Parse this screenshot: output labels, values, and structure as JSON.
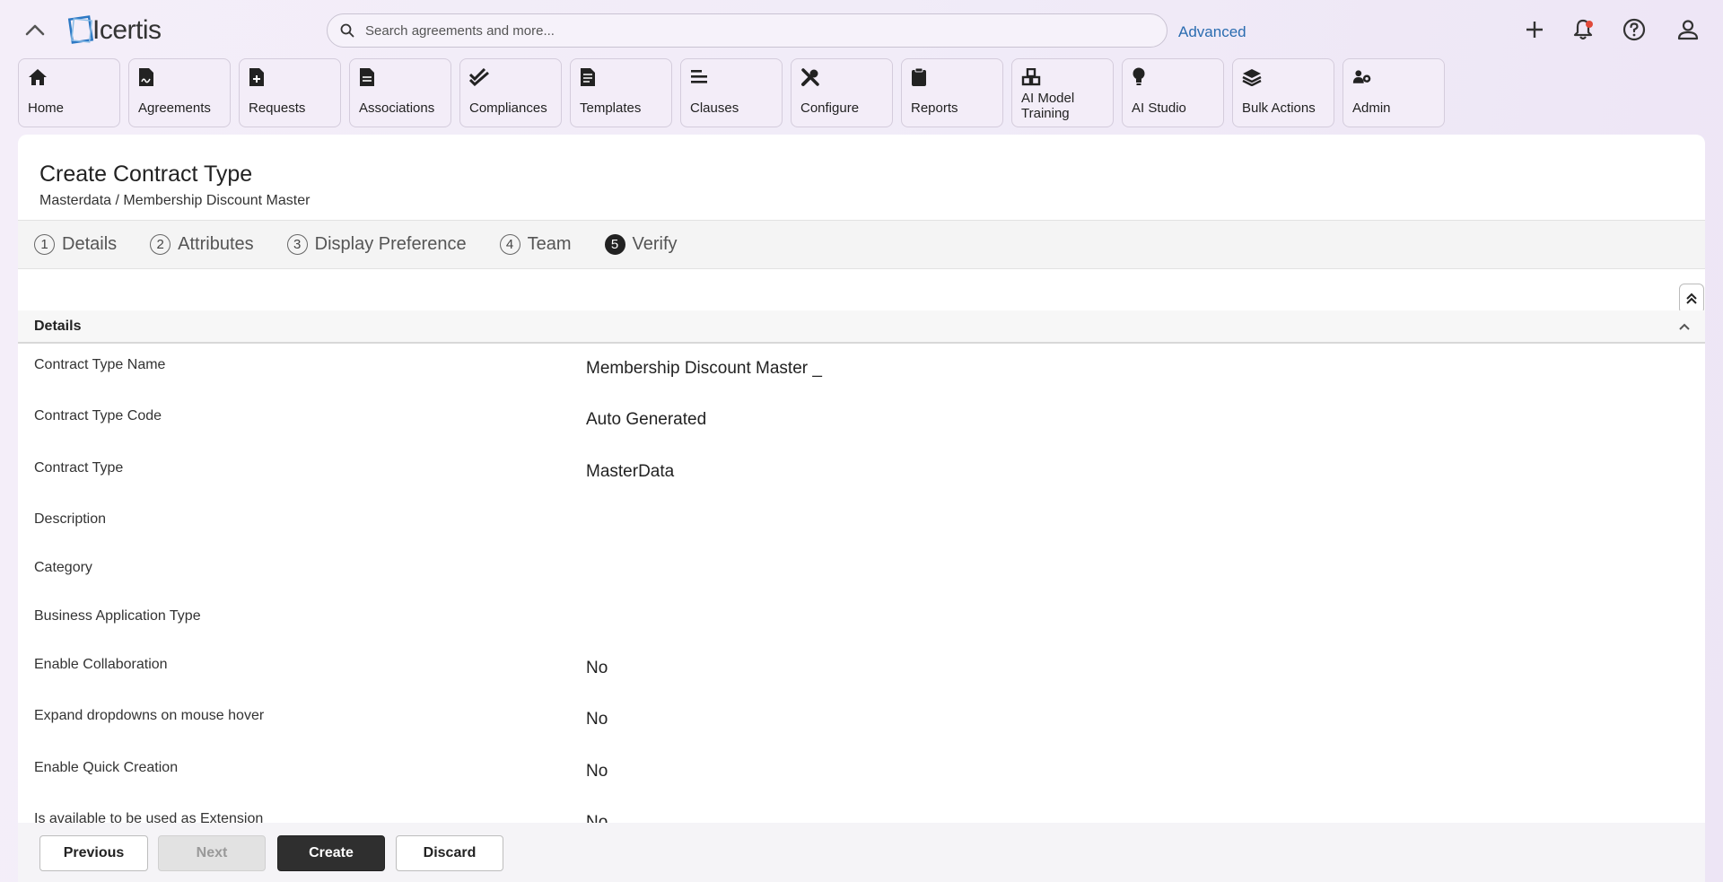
{
  "header": {
    "logo_text": "Icertis",
    "search_placeholder": "Search agreements and more...",
    "advanced_label": "Advanced"
  },
  "modules": [
    {
      "label": "Home",
      "icon": "home-icon"
    },
    {
      "label": "Agreements",
      "icon": "document-signature-icon"
    },
    {
      "label": "Requests",
      "icon": "file-plus-icon"
    },
    {
      "label": "Associations",
      "icon": "document-icon"
    },
    {
      "label": "Compliances",
      "icon": "double-check-icon"
    },
    {
      "label": "Templates",
      "icon": "template-icon"
    },
    {
      "label": "Clauses",
      "icon": "text-lines-icon"
    },
    {
      "label": "Configure",
      "icon": "tools-icon"
    },
    {
      "label": "Reports",
      "icon": "clipboard-icon"
    },
    {
      "label": "AI Model Training",
      "icon": "cubes-icon"
    },
    {
      "label": "AI Studio",
      "icon": "lightbulb-icon"
    },
    {
      "label": "Bulk Actions",
      "icon": "layers-icon"
    },
    {
      "label": "Admin",
      "icon": "users-gear-icon"
    }
  ],
  "page": {
    "title": "Create Contract Type",
    "breadcrumb": "Masterdata / Membership Discount Master"
  },
  "steps": [
    {
      "num": "1",
      "label": "Details",
      "active": false
    },
    {
      "num": "2",
      "label": "Attributes",
      "active": false
    },
    {
      "num": "3",
      "label": "Display Preference",
      "active": false
    },
    {
      "num": "4",
      "label": "Team",
      "active": false
    },
    {
      "num": "5",
      "label": "Verify",
      "active": true
    }
  ],
  "section": {
    "title": "Details"
  },
  "fields": [
    {
      "label": "Contract Type Name",
      "value": "Membership Discount Master _"
    },
    {
      "label": "Contract Type Code",
      "value": "Auto Generated"
    },
    {
      "label": "Contract Type",
      "value": "MasterData"
    },
    {
      "label": "Description",
      "value": ""
    },
    {
      "label": "Category",
      "value": ""
    },
    {
      "label": "Business Application Type",
      "value": ""
    },
    {
      "label": "Enable Collaboration",
      "value": "No"
    },
    {
      "label": "Expand dropdowns on mouse hover",
      "value": "No"
    },
    {
      "label": "Enable Quick Creation",
      "value": "No"
    },
    {
      "label": "Is available to be used as Extension",
      "value": "No"
    }
  ],
  "footer": {
    "previous": "Previous",
    "next": "Next",
    "create": "Create",
    "discard": "Discard"
  }
}
